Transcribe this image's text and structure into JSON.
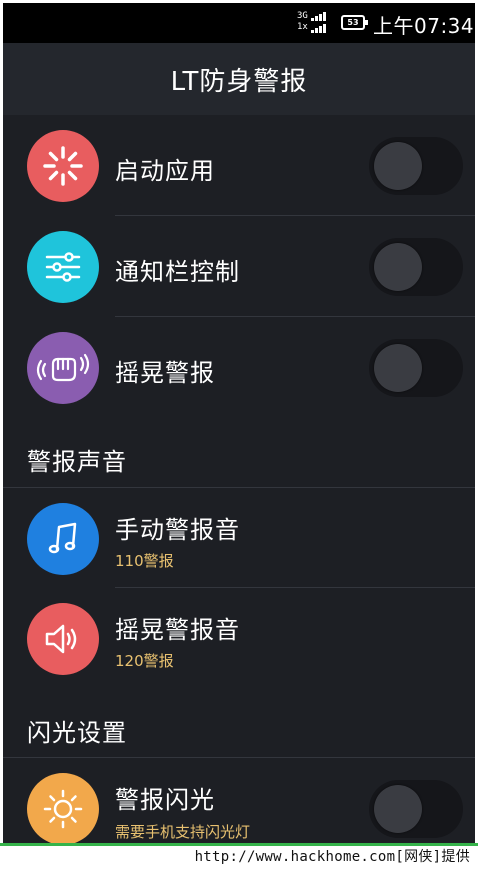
{
  "status_bar": {
    "network_top": "3G",
    "network_bottom": "1x",
    "battery": "53",
    "time": "上午07:34"
  },
  "title": "LT防身警报",
  "toggles": [
    {
      "label": "启动应用",
      "icon": "power-loading-icon",
      "color": "#e85d5f",
      "on": false
    },
    {
      "label": "通知栏控制",
      "icon": "sliders-icon",
      "color": "#1fc4db",
      "on": false
    },
    {
      "label": "摇晃警报",
      "icon": "shake-hand-icon",
      "color": "#8a5db0",
      "on": false
    }
  ],
  "section_sound": "警报声音",
  "sounds": [
    {
      "label": "手动警报音",
      "value": "110警报",
      "icon": "music-note-icon",
      "color": "#1f80e0"
    },
    {
      "label": "摇晃警报音",
      "value": "120警报",
      "icon": "speaker-icon",
      "color": "#e85d5f"
    }
  ],
  "section_flash": "闪光设置",
  "flash": {
    "label": "警报闪光",
    "value": "需要手机支持闪光灯",
    "icon": "sun-icon",
    "color": "#f2a84b",
    "on": false
  },
  "footer": "http://www.hackhome.com[网侠]提供",
  "colors": {
    "background": "#1d1f24",
    "subtext": "#e8c170",
    "footer_bar": "#35b34a"
  }
}
